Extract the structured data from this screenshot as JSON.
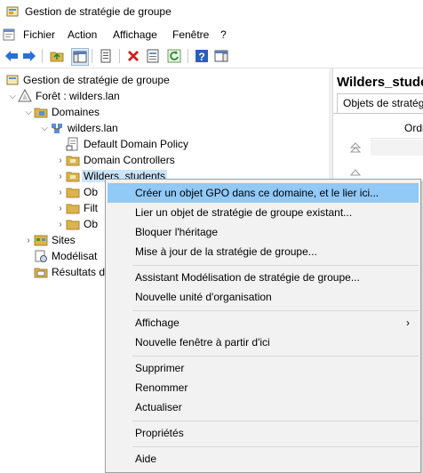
{
  "window": {
    "title": "Gestion de stratégie de groupe"
  },
  "menubar": {
    "items": [
      "Fichier",
      "Action",
      "Affichage",
      "Fenêtre",
      "?"
    ]
  },
  "toolbar": {
    "buttons": [
      "back-arrow-icon",
      "forward-arrow-icon",
      "up-folder-icon",
      "show-hide-tree-icon",
      "properties-icon",
      "delete-icon",
      "export-list-icon",
      "refresh-icon",
      "help-icon",
      "action-pane-icon"
    ]
  },
  "tree": {
    "root": "Gestion de stratégie de groupe",
    "forest": "Forêt : wilders.lan",
    "domains": "Domaines",
    "domain": "wilders.lan",
    "default_policy": "Default Domain Policy",
    "domain_controllers": "Domain Controllers",
    "wilders_students": "Wilders_students",
    "partial_obj1": "Ob",
    "partial_filt": "Filt",
    "partial_obj2": "Ob",
    "sites": "Sites",
    "modeling": "Modélisat",
    "results": "Résultats d"
  },
  "right_pane": {
    "title": "Wilders_stude",
    "tab": "Objets de stratégie",
    "column": "Ordre"
  },
  "context_menu": {
    "items": [
      {
        "label": "Créer un objet GPO dans ce domaine, et le lier ici...",
        "highlighted": true
      },
      {
        "label": "Lier un objet de stratégie de groupe existant..."
      },
      {
        "label": "Bloquer l'héritage"
      },
      {
        "label": "Mise à jour de la stratégie de groupe..."
      },
      {
        "label": "Assistant Modélisation de stratégie de groupe..."
      },
      {
        "label": "Nouvelle unité d'organisation"
      },
      {
        "label": "Affichage",
        "submenu": true
      },
      {
        "label": "Nouvelle fenêtre à partir d'ici"
      },
      {
        "label": "Supprimer"
      },
      {
        "label": "Renommer"
      },
      {
        "label": "Actualiser"
      },
      {
        "label": "Propriétés"
      },
      {
        "label": "Aide"
      }
    ],
    "submenu_arrow": "›"
  },
  "colors": {
    "highlight": "#91c9f7",
    "selected_node": "#cce4f7",
    "menu_bg": "#f2f2f2",
    "folder": "#dcb44a",
    "delete_red": "#d42020",
    "arrow_blue": "#2a6fd6"
  }
}
